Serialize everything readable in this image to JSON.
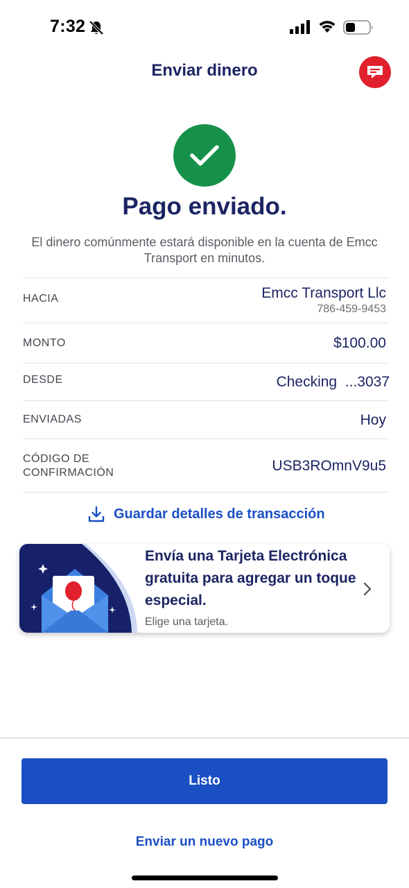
{
  "status_bar": {
    "time": "7:32"
  },
  "header": {
    "title": "Enviar dinero",
    "chat_icon": "chat-bubble-icon"
  },
  "success": {
    "title": "Pago enviado.",
    "message": "El dinero comúnmente estará disponible en la cuenta de Emcc Transport en minutos."
  },
  "details": {
    "to": {
      "label": "HACIA",
      "name": "Emcc Transport Llc",
      "phone": "786-459-9453"
    },
    "amount": {
      "label": "MONTO",
      "value": "$100.00"
    },
    "from": {
      "label": "DESDE",
      "value": "Checking  ...3037"
    },
    "sent": {
      "label": "ENVIADAS",
      "value": "Hoy"
    },
    "confirmation": {
      "label": "CÓDIGO DE CONFIRMACIÓN",
      "value": "USB3ROmnV9u5"
    }
  },
  "save_details_label": "Guardar detalles de transacción",
  "ecard": {
    "title": "Envía una Tarjeta Electrónica gratuita para agregar un toque especial.",
    "subtitle": "Elige una tarjeta."
  },
  "done_label": "Listo",
  "new_payment_label": "Enviar un nuevo pago",
  "colors": {
    "brand_blue": "#1a4fc4",
    "navy": "#1c2563",
    "success_green": "#16914a",
    "chat_red": "#e0202c"
  }
}
